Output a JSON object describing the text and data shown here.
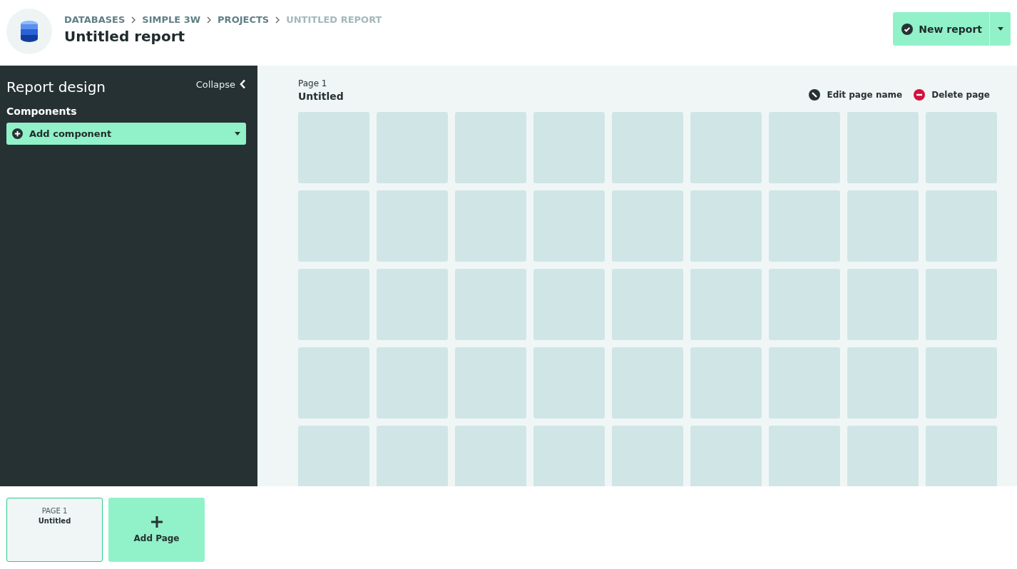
{
  "header": {
    "breadcrumbs": [
      {
        "label": "DATABASES",
        "current": false
      },
      {
        "label": "SIMPLE 3W",
        "current": false
      },
      {
        "label": "PROJECTS",
        "current": false
      },
      {
        "label": "UNTITLED REPORT",
        "current": true
      }
    ],
    "title": "Untitled report",
    "new_button": "New report"
  },
  "sidebar": {
    "title": "Report design",
    "collapse": "Collapse",
    "section": "Components",
    "add_component": "Add component"
  },
  "page": {
    "label": "Page 1",
    "name": "Untitled",
    "actions": [
      {
        "kind": "edit",
        "label": "Edit page name"
      },
      {
        "kind": "delete",
        "label": "Delete page"
      }
    ]
  },
  "page_tabs": [
    {
      "label": "PAGE 1",
      "name": "Untitled",
      "selected": true
    }
  ],
  "add_page": "Add Page"
}
